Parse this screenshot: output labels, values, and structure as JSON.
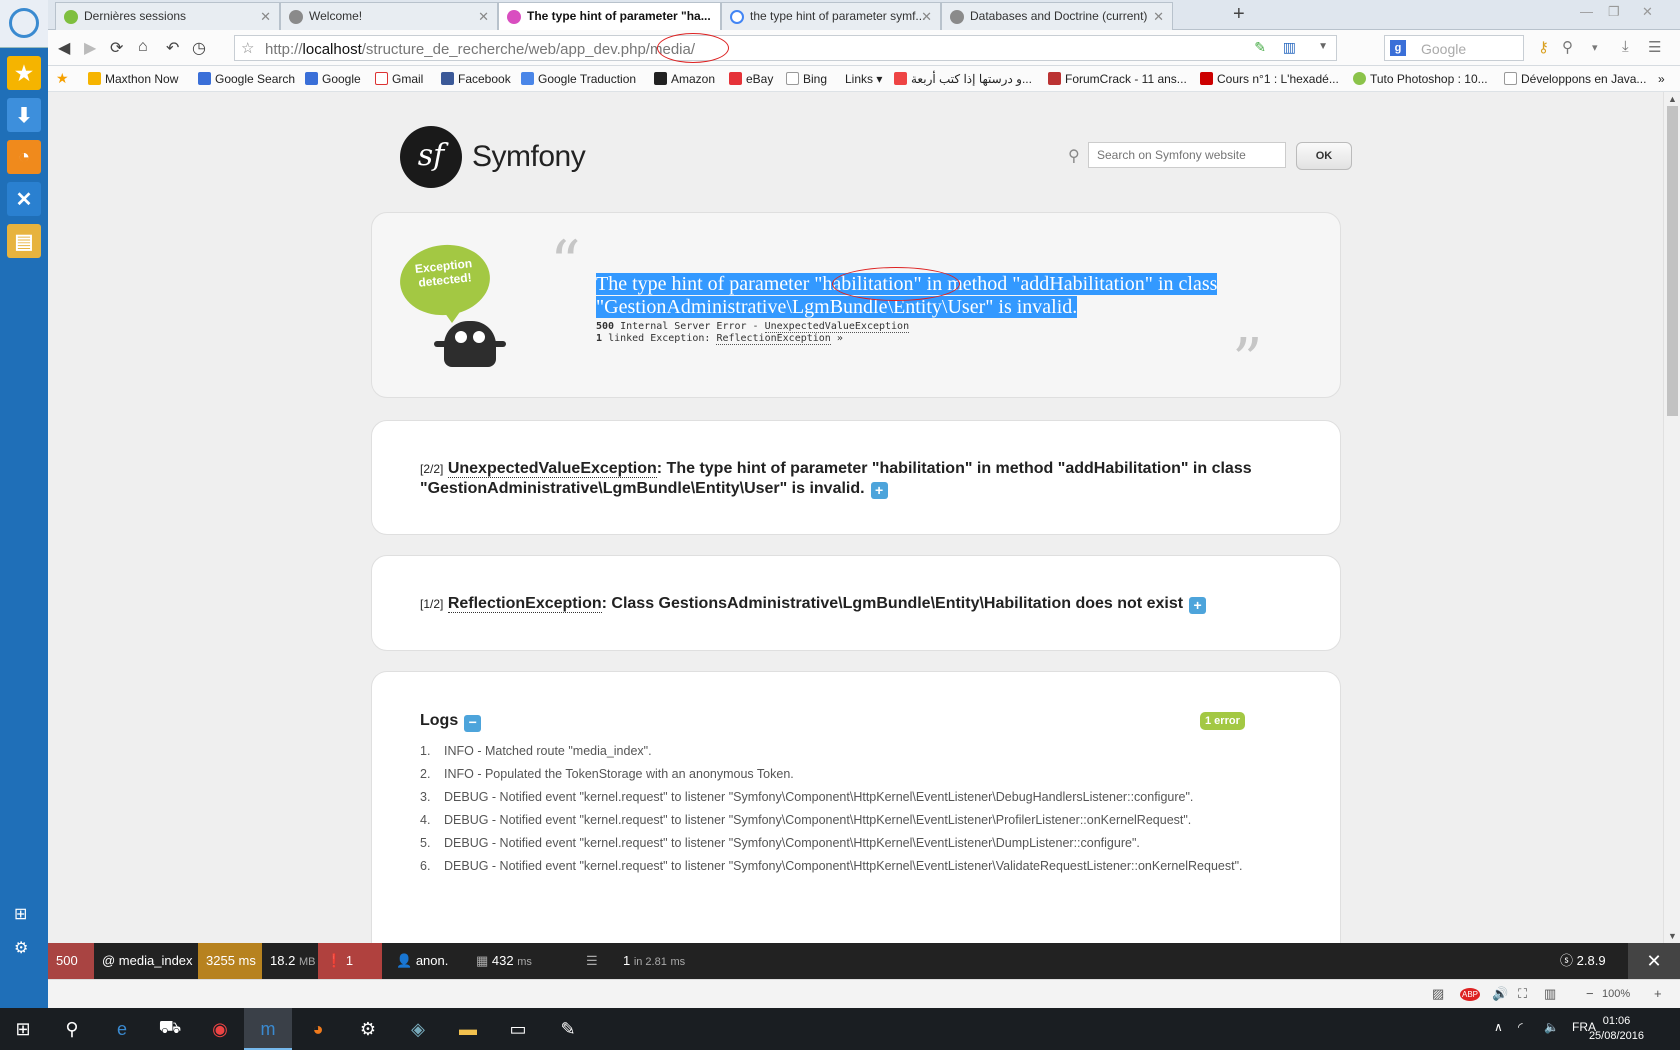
{
  "browser": {
    "tabs": [
      {
        "label": "Dernières sessions"
      },
      {
        "label": "Welcome!"
      },
      {
        "label": "The type hint of parameter \"ha..."
      },
      {
        "label": "the type hint of parameter symf..."
      },
      {
        "label": "Databases and Doctrine (current)"
      }
    ],
    "url_prefix": "http://",
    "url_host": "localhost",
    "url_path": "/structure_de_recherche/web/app_dev.php/media/",
    "search_placeholder": "Google",
    "bookmarks": [
      "Maxthon Now",
      "Google Search",
      "Google",
      "Gmail",
      "Facebook",
      "Google Traduction",
      "Amazon",
      "eBay",
      "Bing",
      "Links ▾",
      "و درستها إذا كتب أربعة...",
      "ForumCrack - 11 ans...",
      "Cours n°1 : L'hexadé...",
      "Tuto Photoshop : 10...",
      "Développons en Java..."
    ]
  },
  "symfony": {
    "logo_text": "Symfony",
    "search_placeholder": "Search on Symfony website",
    "ok_label": "OK",
    "bubble_text": "Exception detected!",
    "message_part1": "The type hint of parameter ",
    "message_highlight": "\"habilitation\"",
    "message_part2": " in method \"addHabilitation\" in class \"GestionAdministrative\\LgmBundle\\Entity\\User\" is invalid.",
    "status_code": "500",
    "status_text": "Internal Server Error - ",
    "status_exception": "UnexpectedValueException",
    "linked_count": "1",
    "linked_text": "linked Exception: ",
    "linked_exception": "ReflectionException",
    "linked_suffix": " »",
    "trace2_num": "[2/2]",
    "trace2_class": "UnexpectedValueException",
    "trace2_msg": ": The type hint of parameter \"habilitation\" in method \"addHabilitation\" in class \"GestionAdministrative\\LgmBundle\\Entity\\User\" is invalid.",
    "trace1_num": "[1/2]",
    "trace1_class": "ReflectionException",
    "trace1_msg": ": Class GestionsAdministrative\\LgmBundle\\Entity\\Habilitation does not exist",
    "logs_title": "Logs",
    "logs_badge": "1 error",
    "logs": [
      {
        "n": "1.",
        "text": "INFO - Matched route \"media_index\"."
      },
      {
        "n": "2.",
        "text": "INFO - Populated the TokenStorage with an anonymous Token."
      },
      {
        "n": "3.",
        "text": "DEBUG - Notified event \"kernel.request\" to listener \"Symfony\\Component\\HttpKernel\\EventListener\\DebugHandlersListener::configure\"."
      },
      {
        "n": "4.",
        "text": "DEBUG - Notified event \"kernel.request\" to listener \"Symfony\\Component\\HttpKernel\\EventListener\\ProfilerListener::onKernelRequest\"."
      },
      {
        "n": "5.",
        "text": "DEBUG - Notified event \"kernel.request\" to listener \"Symfony\\Component\\HttpKernel\\EventListener\\DumpListener::configure\"."
      },
      {
        "n": "6.",
        "text": "DEBUG - Notified event \"kernel.request\" to listener \"Symfony\\Component\\HttpKernel\\EventListener\\ValidateRequestListener::onKernelRequest\"."
      }
    ]
  },
  "toolbar": {
    "status": "500",
    "route": "@ media_index",
    "time": "3255 ms",
    "memory_value": "18.2",
    "memory_unit": "MB",
    "errors": "1",
    "user": "anon.",
    "init_value": "432",
    "init_unit": "ms",
    "db_value": "1",
    "db_rest": "in 2.81",
    "db_unit": "ms",
    "version": "2.8.9",
    "colors": {
      "status": "#a94442",
      "time": "#b7821f",
      "errors": "#b0413e"
    }
  },
  "statusbar": {
    "zoom": "100%"
  },
  "taskbar": {
    "lang": "FRA",
    "time": "01:06",
    "date": "25/08/2016"
  }
}
